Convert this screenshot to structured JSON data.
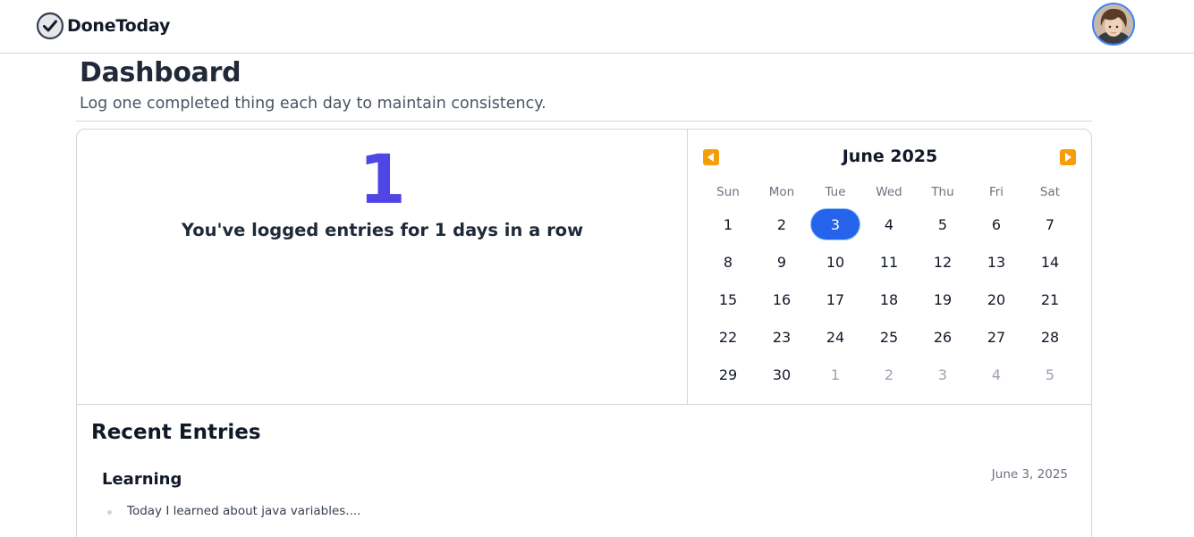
{
  "app": {
    "name": "DoneToday",
    "logo_icon": "check-circle-icon"
  },
  "user": {
    "avatar_icon": "user-avatar"
  },
  "header": {
    "title": "Dashboard",
    "subtitle": "Log one completed thing each day to maintain consistency."
  },
  "streak": {
    "count": "1",
    "text": "You've logged entries for 1 days in a row",
    "color": "#4f46e5"
  },
  "calendar": {
    "month_label": "June 2025",
    "prev_icon": "triangle-left-icon",
    "next_icon": "triangle-right-icon",
    "weekdays": [
      "Sun",
      "Mon",
      "Tue",
      "Wed",
      "Thu",
      "Fri",
      "Sat"
    ],
    "days": [
      "1",
      "2",
      "3",
      "4",
      "5",
      "6",
      "7",
      "8",
      "9",
      "10",
      "11",
      "12",
      "13",
      "14",
      "15",
      "16",
      "17",
      "18",
      "19",
      "20",
      "21",
      "22",
      "23",
      "24",
      "25",
      "26",
      "27",
      "28",
      "29",
      "30",
      "1",
      "2",
      "3",
      "4",
      "5"
    ],
    "outside_from_index": 30,
    "selected_index": 2,
    "accent": "#2563eb",
    "nav_color": "#f59e0b"
  },
  "recent": {
    "title": "Recent Entries",
    "entries": [
      {
        "title": "Learning",
        "date": "June 3, 2025",
        "items": [
          "Today I learned about java variables...."
        ]
      }
    ]
  }
}
